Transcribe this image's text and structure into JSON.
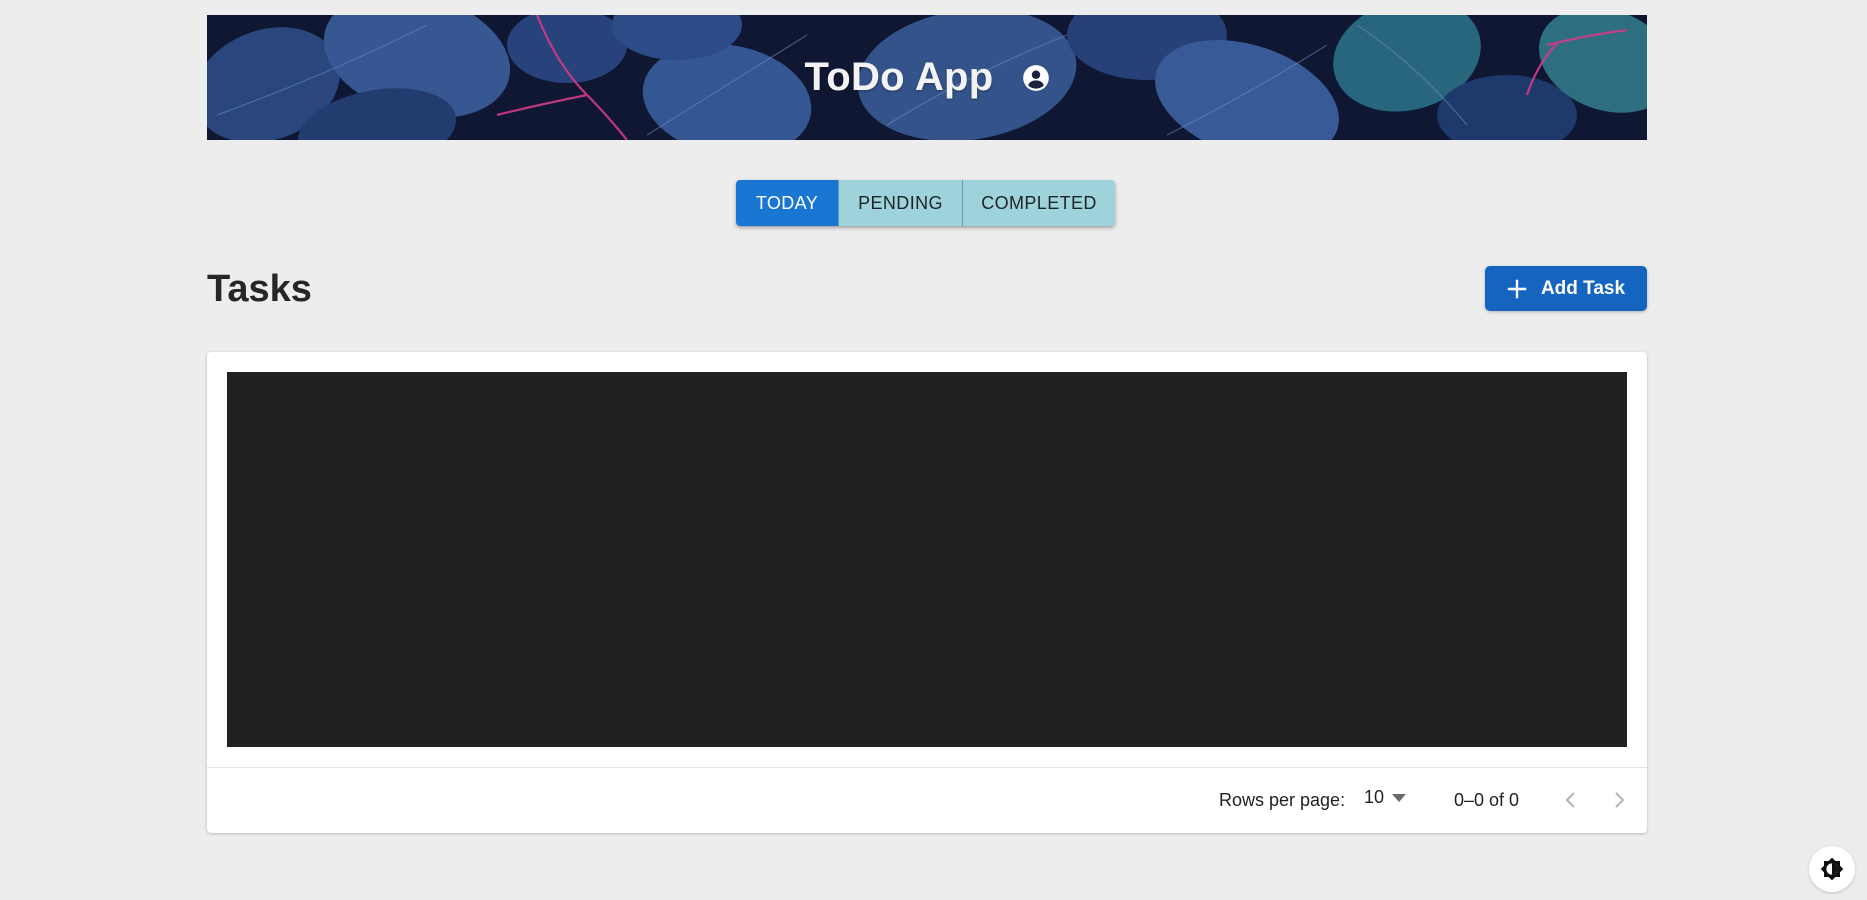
{
  "header": {
    "title": "ToDo App",
    "account_icon": "account-circle-icon"
  },
  "tabs": [
    {
      "label": "TODAY",
      "active": true
    },
    {
      "label": "PENDING",
      "active": false
    },
    {
      "label": "COMPLETED",
      "active": false
    }
  ],
  "main": {
    "title": "Tasks",
    "add_button_label": "Add Task",
    "add_icon": "plus-icon"
  },
  "pagination": {
    "rows_per_page_label": "Rows per page:",
    "rows_per_page_value": "10",
    "range_text": "0–0 of 0",
    "prev_icon": "chevron-left-icon",
    "next_icon": "chevron-right-icon"
  },
  "theme_toggle_icon": "brightness-icon",
  "colors": {
    "primary": "#1976d2",
    "tab_inactive": "#9fd3db",
    "page_background": "#ededed",
    "grid_background": "#212121"
  }
}
